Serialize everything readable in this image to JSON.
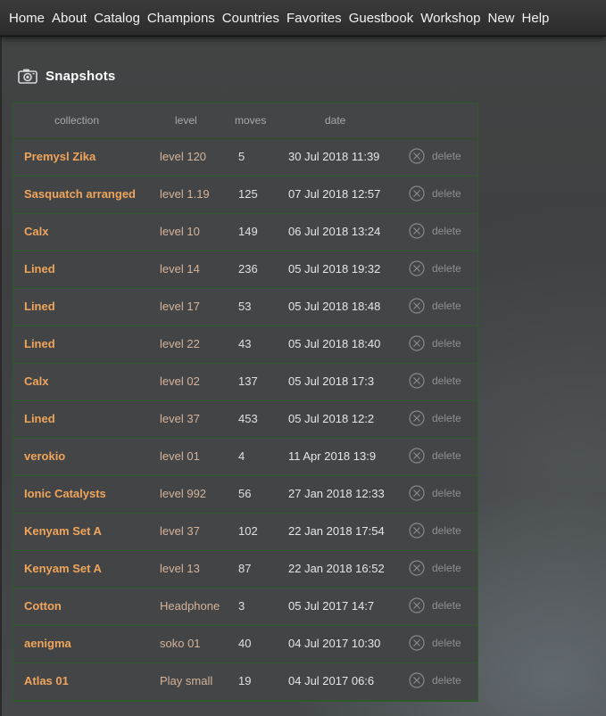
{
  "nav": {
    "items": [
      "Home",
      "About",
      "Catalog",
      "Champions",
      "Countries",
      "Favorites",
      "Guestbook",
      "Workshop",
      "New",
      "Help"
    ]
  },
  "section": {
    "title": "Snapshots",
    "icon": "camera-icon"
  },
  "table": {
    "headers": {
      "collection": "collection",
      "level": "level",
      "moves": "moves",
      "date": "date"
    },
    "delete_label": "delete",
    "delete_icon": "circle-x-icon",
    "rows": [
      {
        "collection": "Premysl Zika",
        "level": "level 120",
        "moves": "5",
        "date": "30 Jul 2018 11:39"
      },
      {
        "collection": "Sasquatch arranged",
        "level": "level 1.19",
        "moves": "125",
        "date": "07 Jul 2018 12:57"
      },
      {
        "collection": "Calx",
        "level": "level 10",
        "moves": "149",
        "date": "06 Jul 2018 13:24"
      },
      {
        "collection": "Lined",
        "level": "level 14",
        "moves": "236",
        "date": "05 Jul 2018 19:32"
      },
      {
        "collection": "Lined",
        "level": "level 17",
        "moves": "53",
        "date": "05 Jul 2018 18:48"
      },
      {
        "collection": "Lined",
        "level": "level 22",
        "moves": "43",
        "date": "05 Jul 2018 18:40"
      },
      {
        "collection": "Calx",
        "level": "level 02",
        "moves": "137",
        "date": "05 Jul 2018 17:3"
      },
      {
        "collection": "Lined",
        "level": "level 37",
        "moves": "453",
        "date": "05 Jul 2018 12:2"
      },
      {
        "collection": "verokio",
        "level": "level 01",
        "moves": "4",
        "date": "11 Apr 2018 13:9"
      },
      {
        "collection": "Ionic Catalysts",
        "level": "level 992",
        "moves": "56",
        "date": "27 Jan 2018 12:33"
      },
      {
        "collection": "Kenyam Set A",
        "level": "level 37",
        "moves": "102",
        "date": "22 Jan 2018 17:54"
      },
      {
        "collection": "Kenyam Set A",
        "level": "level 13",
        "moves": "87",
        "date": "22 Jan 2018 16:52"
      },
      {
        "collection": "Cotton",
        "level": "Headphone",
        "moves": "3",
        "date": "05 Jul 2017 14:7"
      },
      {
        "collection": "aenigma",
        "level": "soko 01",
        "moves": "40",
        "date": "04 Jul 2017 10:30"
      },
      {
        "collection": "Atlas 01",
        "level": "Play small",
        "moves": "19",
        "date": "04 Jul 2017 06:6"
      }
    ]
  },
  "colors": {
    "accent_orange": "#f0a55c",
    "table_border_green": "#2f5a2a",
    "nav_bg": "#2c2c2c"
  }
}
